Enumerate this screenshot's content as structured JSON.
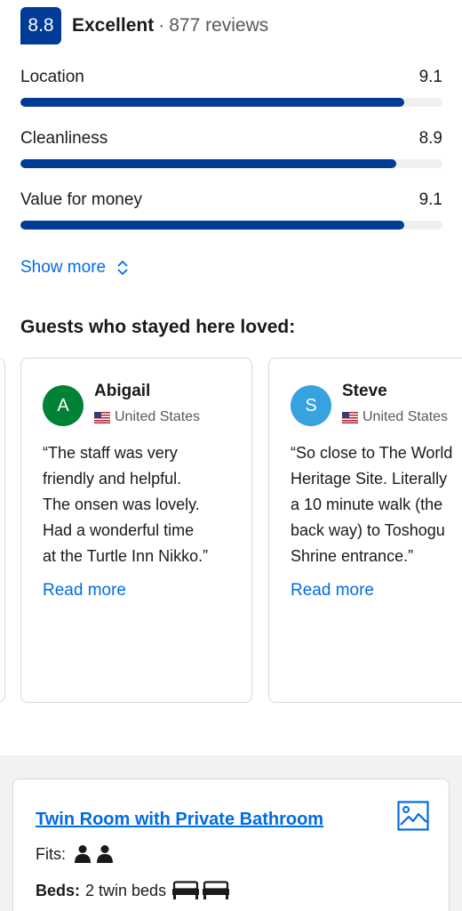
{
  "rating": {
    "score": "8.8",
    "word": "Excellent",
    "separator": "·",
    "reviews": "877 reviews"
  },
  "categories": [
    {
      "label": "Location",
      "value": "9.1",
      "fraction": 0.91
    },
    {
      "label": "Cleanliness",
      "value": "8.9",
      "fraction": 0.89
    },
    {
      "label": "Value for money",
      "value": "9.1",
      "fraction": 0.91
    }
  ],
  "show_more": {
    "label": "Show more"
  },
  "loved": {
    "title": "Guests who stayed here loved:",
    "reviews": [
      {
        "initial": "A",
        "name": "Abigail",
        "country": "United States",
        "avatar_color": "#008234",
        "quote": [
          "“The staff was very",
          "friendly and helpful.",
          "The onsen was lovely.",
          "Had a wonderful time",
          "at the Turtle Inn Nikko.”"
        ],
        "read_more": "Read more"
      },
      {
        "initial": "S",
        "name": "Steve",
        "country": "United States",
        "avatar_color": "#36a3e0",
        "quote": [
          "“So close to The World",
          "Heritage Site. Literally",
          "a 10 minute walk (the",
          "back way) to Toshogu",
          "Shrine entrance.”"
        ],
        "read_more": "Read more"
      }
    ]
  },
  "room": {
    "title": "Twin Room with Private Bathroom",
    "fits_label": "Fits:",
    "beds_label": "Beds:",
    "beds_value": "2 twin beds",
    "guest_icons": [
      "person-icon",
      "person-icon"
    ],
    "bed_icons": [
      "bed-icon",
      "bed-icon"
    ]
  },
  "colors": {
    "brand_blue": "#003b95",
    "link_blue": "#006ce4"
  }
}
